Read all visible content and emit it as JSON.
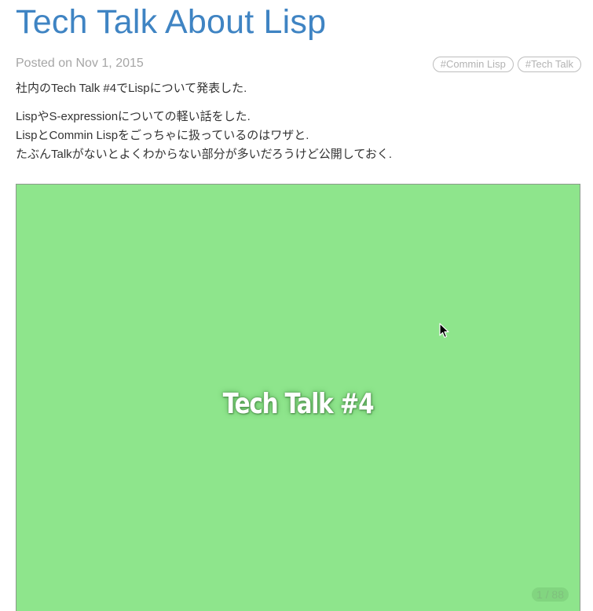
{
  "post": {
    "title": "Tech Talk About Lisp",
    "posted": "Posted on Nov 1, 2015",
    "tags": [
      "#Commin Lisp",
      "#Tech Talk"
    ]
  },
  "content": {
    "paragraph1": "社内のTech Talk #4でLispについて発表した.",
    "lines": [
      "LispやS-expressionについての軽い話をした.",
      "LispとCommin Lispをごっちゃに扱っているのはワザと.",
      "たぶんTalkがないとよくわからない部分が多いだろうけど公開しておく."
    ]
  },
  "slide": {
    "title": "Tech Talk #4",
    "counter": "1 / 88",
    "background_color": "#8ee58c"
  },
  "colors": {
    "title": "#3f84c3",
    "meta": "#a6a6a6",
    "text": "#333333"
  },
  "icons": {
    "cursor": "mouse-pointer-icon"
  }
}
